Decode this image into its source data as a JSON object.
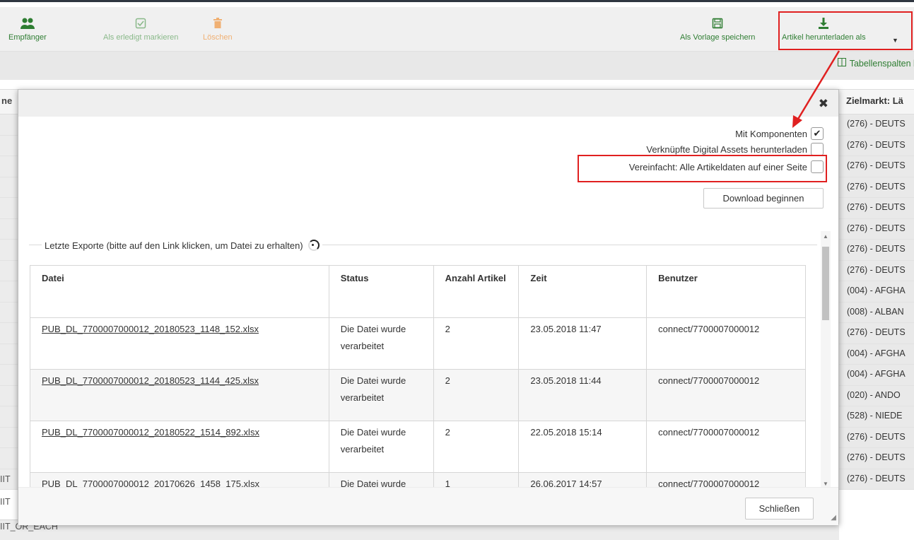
{
  "toolbar": {
    "recipients_label": "Empfänger",
    "mark_done_label": "Als erledigt markieren",
    "delete_label": "Löschen",
    "save_template_label": "Als Vorlage speichern",
    "download_as_label": "Artikel herunterladen als"
  },
  "table_columns_link": "Tabellenspalten b",
  "background": {
    "left_header_fragment": "ne",
    "right_header": "Zielmarkt: Lä",
    "right_cells": [
      "(276) - DEUTS",
      "(276) - DEUTS",
      "(276) - DEUTS",
      "(276) - DEUTS",
      "(276) - DEUTS",
      "(276) - DEUTS",
      "(276) - DEUTS",
      "(276) - DEUTS",
      "(004) - AFGHA",
      "(008) - ALBAN",
      "(276) - DEUTS",
      "(004) - AFGHA",
      "(004) - AFGHA",
      "(020) - ANDO",
      "(528) - NIEDE",
      "(276) - DEUTS",
      "(276) - DEUTS",
      "(276) - DEUTS"
    ],
    "left_fragments": [
      "IIT",
      "IIT",
      "IIT_OR_EACH"
    ]
  },
  "dialog": {
    "options": [
      {
        "label": "Mit Komponenten",
        "checked": true
      },
      {
        "label": "Verknüpfte Digital Assets herunterladen",
        "checked": false
      },
      {
        "label": "Vereinfacht: Alle Artikeldaten auf einer Seite",
        "checked": false
      }
    ],
    "download_button": "Download beginnen",
    "recent_exports_legend": "Letzte Exporte (bitte auf den Link klicken, um Datei zu erhalten)",
    "columns": [
      "Datei",
      "Status",
      "Anzahl Artikel",
      "Zeit",
      "Benutzer"
    ],
    "rows": [
      {
        "file": "PUB_DL_7700007000012_20180523_1148_152.xlsx",
        "status": "Die Datei wurde verarbeitet",
        "count": "2",
        "time": "23.05.2018 11:47",
        "user": "connect/7700007000012"
      },
      {
        "file": "PUB_DL_7700007000012_20180523_1144_425.xlsx",
        "status": "Die Datei wurde verarbeitet",
        "count": "2",
        "time": "23.05.2018 11:44",
        "user": "connect/7700007000012"
      },
      {
        "file": "PUB_DL_7700007000012_20180522_1514_892.xlsx",
        "status": "Die Datei wurde verarbeitet",
        "count": "2",
        "time": "22.05.2018 15:14",
        "user": "connect/7700007000012"
      },
      {
        "file": "PUB_DL_7700007000012_20170626_1458_175.xlsx",
        "status": "Die Datei wurde",
        "count": "1",
        "time": "26.06.2017 14:57",
        "user": "connect/7700007000012"
      }
    ],
    "close_button": "Schließen"
  },
  "colors": {
    "accent": "#2e7d32",
    "highlight": "#e02020"
  }
}
